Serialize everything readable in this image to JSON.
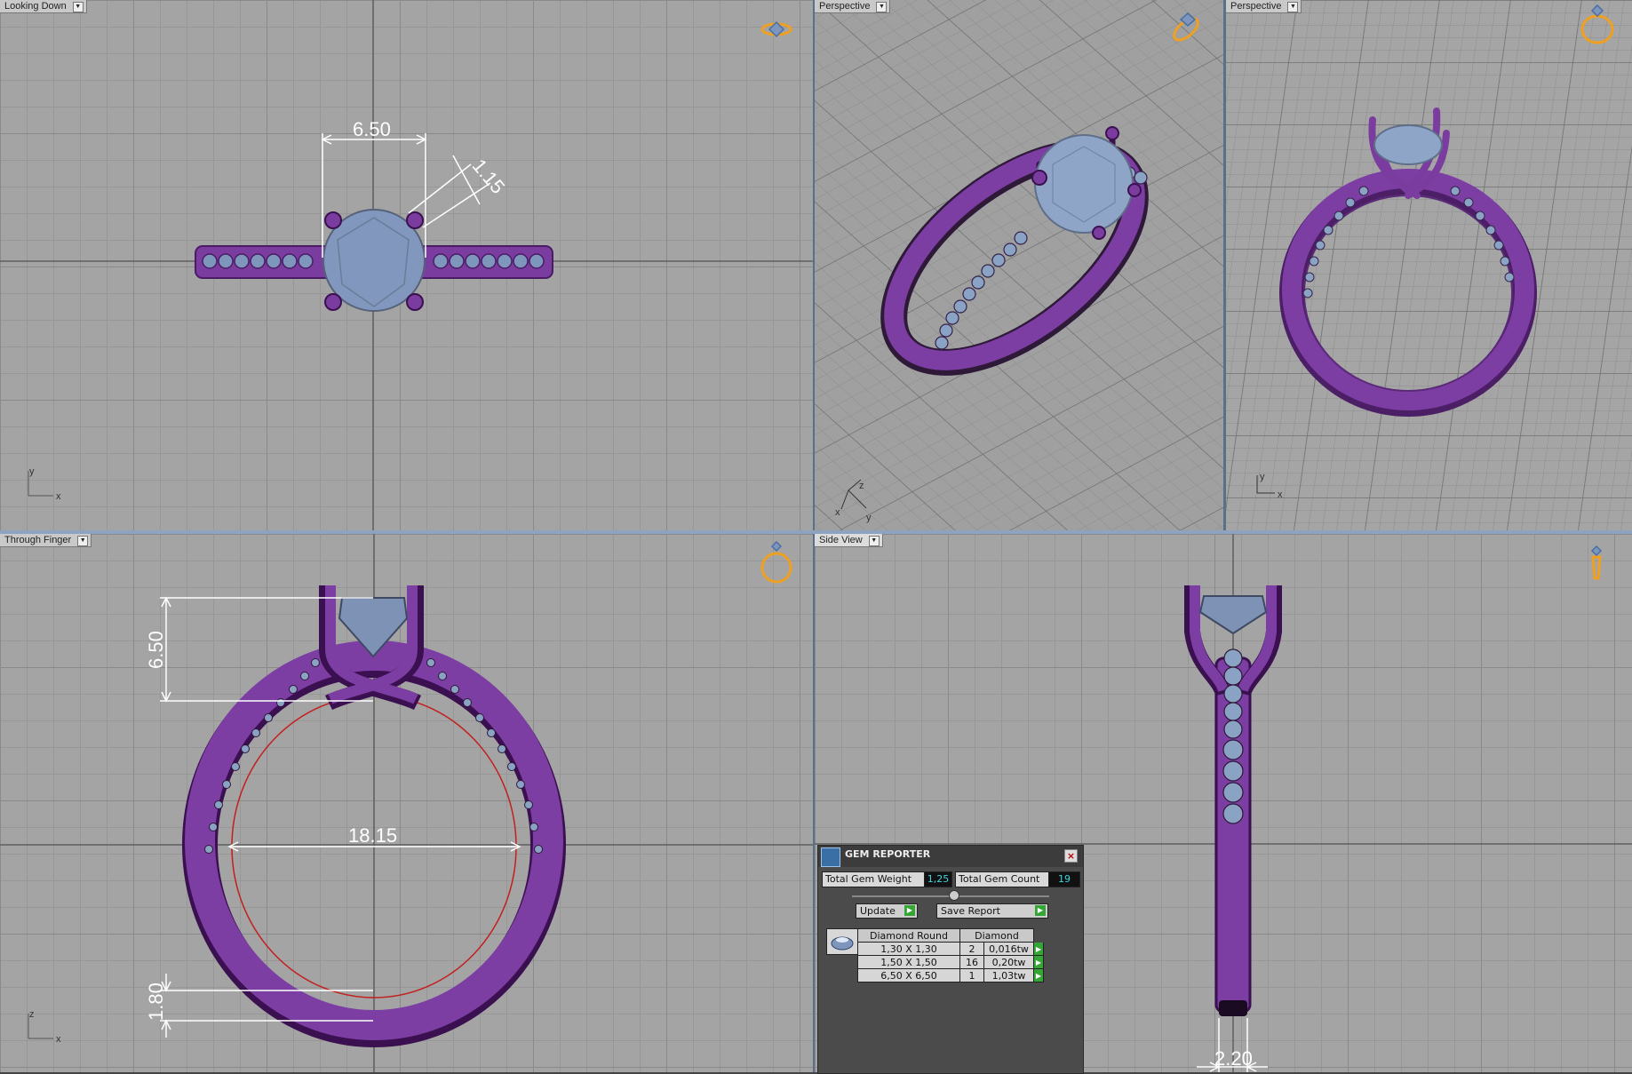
{
  "viewports": {
    "top_left": {
      "label": "Looking Down",
      "axes": {
        "a": "y",
        "b": "x"
      },
      "dims": {
        "width": "6.50",
        "prong": "1.15"
      }
    },
    "top_mid": {
      "label": "Perspective",
      "axes": {
        "a": "z",
        "b": "x",
        "c": "y"
      }
    },
    "top_right": {
      "label": "Perspective",
      "axes": {
        "a": "y",
        "b": "x"
      }
    },
    "bottom_left": {
      "label": "Through Finger",
      "axes": {
        "a": "z",
        "b": "x"
      },
      "dims": {
        "height": "6.50",
        "inner": "18.15",
        "shank": "1.80"
      }
    },
    "bottom_right": {
      "label": "Side View",
      "dims": {
        "width": "2.20"
      }
    }
  },
  "gem_reporter": {
    "title": "GEM REPORTER",
    "total_weight_label": "Total Gem Weight",
    "total_weight_value": "1,25",
    "total_count_label": "Total Gem Count",
    "total_count_value": "19",
    "update_label": "Update",
    "save_label": "Save Report",
    "table_head": {
      "shape": "Diamond Round",
      "material": "Diamond"
    },
    "rows": [
      {
        "size": "1,30 X 1,30",
        "count": "2",
        "weight": "0,016tw"
      },
      {
        "size": "1,50 X 1,50",
        "count": "16",
        "weight": "0,20tw"
      },
      {
        "size": "6,50 X 6,50",
        "count": "1",
        "weight": "1,03tw"
      }
    ]
  },
  "colors": {
    "metal": "#7a3c9e",
    "gem": "#7f96bc",
    "viewport_bg": "#a4a4a4",
    "dimension": "#ffffff",
    "orientation_icon": "#f0a020"
  }
}
